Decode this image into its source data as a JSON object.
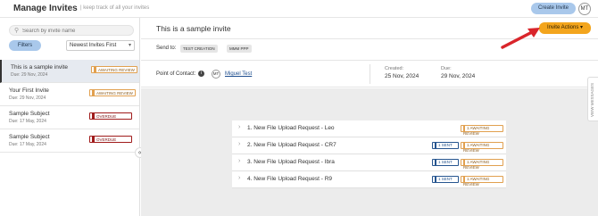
{
  "header": {
    "title": "Manage Invites",
    "subtitle": "| keep track of all your invites",
    "create_button": "Create Invite",
    "user_initials": "MT"
  },
  "sidebar": {
    "search_placeholder": "Search by invite name",
    "filters_label": "Filters",
    "sort_value": "Newest Invites First",
    "invites": [
      {
        "title": "This is a sample invite",
        "due": "Due: 29 Nov, 2024",
        "status": "AWAITING REVIEW"
      },
      {
        "title": "Your First Invite",
        "due": "Due: 29 Nov, 2024",
        "status": "AWAITING REVIEW"
      },
      {
        "title": "Sample Subject",
        "due": "Due: 17 May, 2024",
        "status": "OVERDUE"
      },
      {
        "title": "Sample Subject",
        "due": "Due: 17 May, 2024",
        "status": "OVERDUE"
      }
    ]
  },
  "main": {
    "invite_title": "This is a sample invite",
    "actions_button": "Invite Actions",
    "send_to_label": "Send to:",
    "send_to_tags": [
      "TEST CREATION",
      "MMM PPP"
    ],
    "poc_label": "Point of Contact:",
    "poc_initials": "MT",
    "poc_name": "Miguel Test",
    "created_label": "Created:",
    "created_value": "25 Nov, 2024",
    "due_label": "Due:",
    "due_value": "29 Nov, 2024",
    "side_tab": "VIEW MESSAGES",
    "requests": [
      {
        "title": "1. New File Upload Request - Leo",
        "sent": "",
        "status": "AWAITING REVIEW"
      },
      {
        "title": "2. New File Upload Request - CR7",
        "sent": "SENT",
        "status": "AWAITING REVIEW"
      },
      {
        "title": "3. New File Upload Request - Ibra",
        "sent": "SENT",
        "status": "AWAITING REVIEW"
      },
      {
        "title": "4. New File Upload Request - R9",
        "sent": "SENT",
        "status": "AWAITING REVIEW"
      }
    ]
  },
  "colors": {
    "accent_blue": "#a9c8eb",
    "actions_orange": "#f3a51d",
    "awaiting_orange": "#e1a04f",
    "overdue_red": "#a01b1b",
    "arrow_red": "#d9252b"
  },
  "icons": [
    "search-icon",
    "chevron-down-icon",
    "info-icon",
    "chevron-right-icon",
    "collapse-left-icon",
    "arrow-icon"
  ]
}
